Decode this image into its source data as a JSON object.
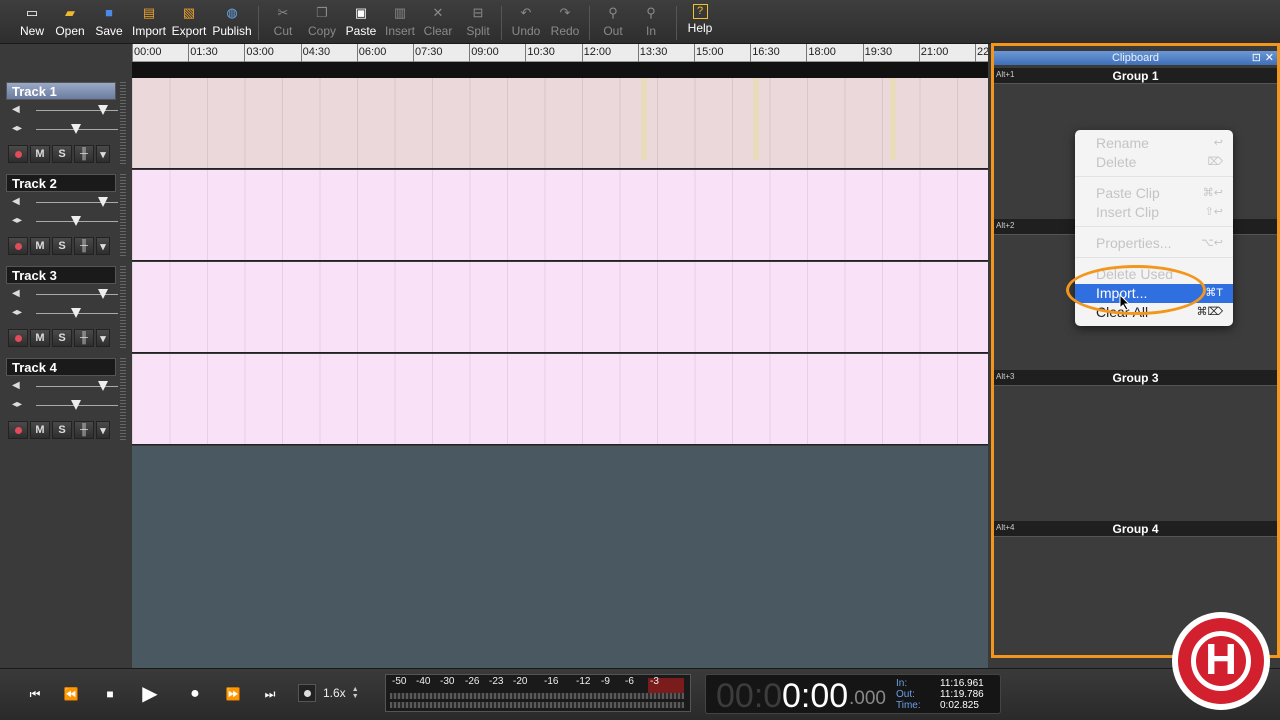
{
  "toolbar": {
    "buttons": [
      {
        "label": "New",
        "icon": "new-file-icon"
      },
      {
        "label": "Open",
        "icon": "folder-open-icon"
      },
      {
        "label": "Save",
        "icon": "save-disk-icon"
      },
      {
        "label": "Import",
        "icon": "import-icon"
      },
      {
        "label": "Export",
        "icon": "export-icon"
      },
      {
        "label": "Publish",
        "icon": "globe-icon"
      },
      {
        "label": "Cut",
        "icon": "scissors-icon"
      },
      {
        "label": "Copy",
        "icon": "copy-icon"
      },
      {
        "label": "Paste",
        "icon": "clipboard-icon"
      },
      {
        "label": "Insert",
        "icon": "insert-icon"
      },
      {
        "label": "Clear",
        "icon": "clear-icon"
      },
      {
        "label": "Split",
        "icon": "split-icon"
      },
      {
        "label": "Undo",
        "icon": "undo-icon"
      },
      {
        "label": "Redo",
        "icon": "redo-icon"
      },
      {
        "label": "Out",
        "icon": "zoom-out-icon"
      },
      {
        "label": "In",
        "icon": "zoom-in-icon"
      },
      {
        "label": "Help",
        "icon": "help-icon"
      }
    ]
  },
  "ruler": {
    "ticks": [
      "00:00",
      "01:30",
      "03:00",
      "04:30",
      "06:00",
      "07:30",
      "09:00",
      "10:30",
      "12:00",
      "13:30",
      "15:00",
      "16:30",
      "18:00",
      "19:30",
      "21:00",
      "22"
    ]
  },
  "tracks": [
    {
      "name": "Track 1"
    },
    {
      "name": "Track 2"
    },
    {
      "name": "Track 3"
    },
    {
      "name": "Track 4"
    }
  ],
  "track_button_labels": {
    "mute": "M",
    "solo": "S"
  },
  "clipboard": {
    "title": "Clipboard",
    "groups": [
      {
        "shortcut": "Alt+1",
        "name": "Group 1"
      },
      {
        "shortcut": "Alt+2",
        "name": ""
      },
      {
        "shortcut": "Alt+3",
        "name": "Group 3"
      },
      {
        "shortcut": "Alt+4",
        "name": "Group 4"
      }
    ]
  },
  "context_menu": {
    "items": [
      {
        "label": "Rename",
        "shortcut": "↩"
      },
      {
        "label": "Delete",
        "shortcut": "⌦"
      },
      {
        "label": "Paste Clip",
        "shortcut": "⌘↩"
      },
      {
        "label": "Insert Clip",
        "shortcut": "⇧↩"
      },
      {
        "label": "Properties...",
        "shortcut": "⌥↩"
      },
      {
        "label": "Delete Used",
        "shortcut": ""
      },
      {
        "label": "Import...",
        "shortcut": "⌘T"
      },
      {
        "label": "Clear All",
        "shortcut": "⌘⌦"
      }
    ]
  },
  "transport": {
    "speed": "1.6x",
    "meter_labels": [
      "-50",
      "-40",
      "-30",
      "-26",
      "-23",
      "-20",
      "-16",
      "-12",
      "-9",
      "-6",
      "-3"
    ],
    "clock": {
      "dim_prefix": "00:0",
      "main": "0:00",
      "fraction": ".000",
      "in_label": "In:",
      "in_value": "11:16.961",
      "out_label": "Out:",
      "out_value": "11:19.786",
      "time_label": "Time:",
      "time_value": "0:02.825"
    }
  },
  "colors": {
    "accent_orange": "#f3961c",
    "highlight_blue": "#2f6fe0",
    "logo_red": "#d3202f"
  }
}
